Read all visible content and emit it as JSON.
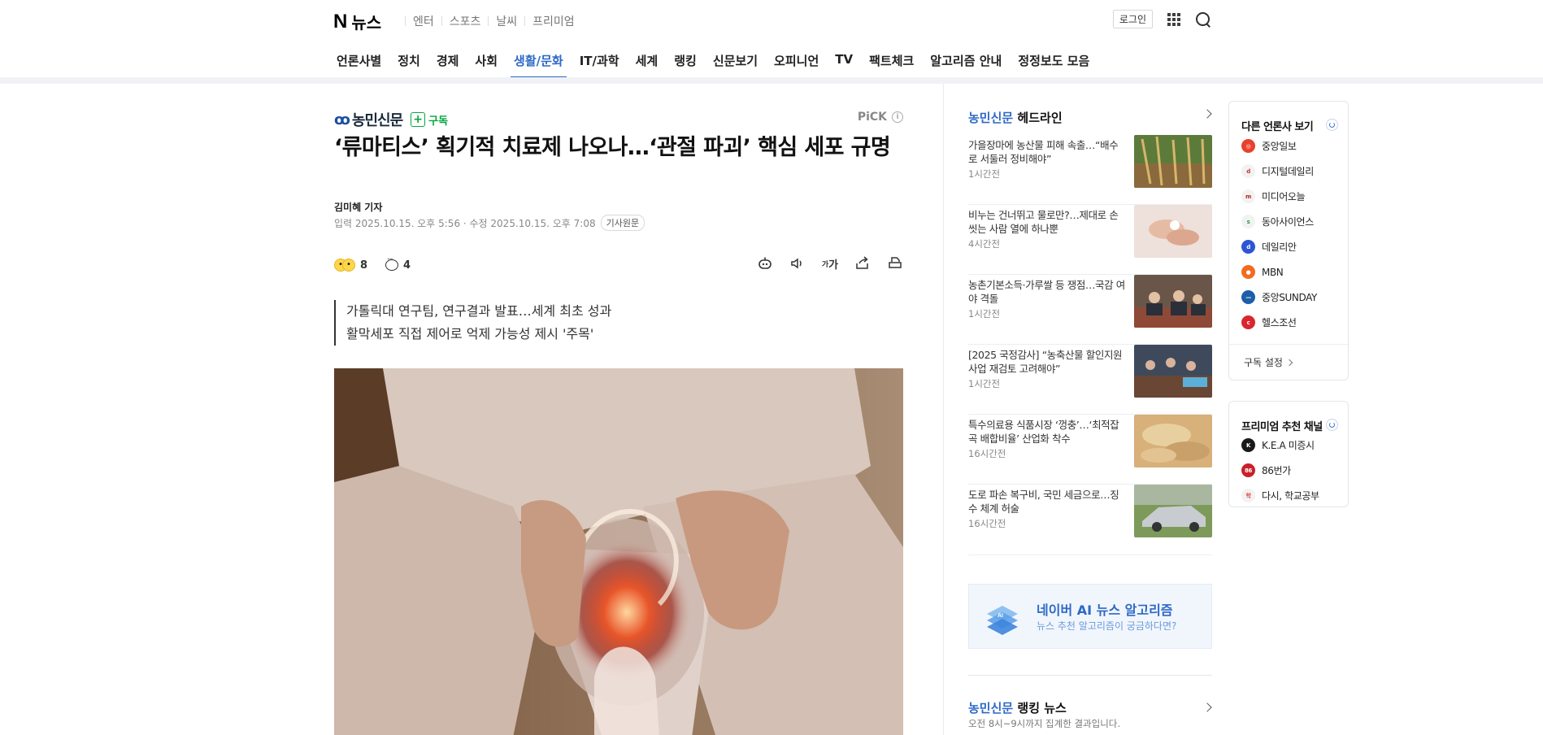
{
  "gnb": {
    "logo_n": "N",
    "logo_word": "뉴스",
    "services": [
      "엔터",
      "스포츠",
      "날씨",
      "프리미엄"
    ],
    "login": "로그인",
    "menu": [
      "언론사별",
      "정치",
      "경제",
      "사회",
      "생활/문화",
      "IT/과학",
      "세계",
      "랭킹",
      "신문보기",
      "오피니언",
      "TV",
      "팩트체크",
      "알고리즘 안내",
      "정정보도 모음"
    ],
    "active_menu": "생활/문화"
  },
  "article": {
    "press": "농민신문",
    "subscribe": "구독",
    "pick": "PiCK",
    "headline": "‘류마티스’ 획기적 치료제 나오나…‘관절 파괴’ 핵심 세포 규명",
    "reporter": "김미혜 기자",
    "dates": "입력 2025.10.15. 오후 5:56 · 수정 2025.10.15. 오후 7:08",
    "original_btn": "기사원문",
    "reaction_count": "8",
    "comment_count": "4",
    "font_tool": "가",
    "summary_lines": [
      "가톨릭대 연구팀, 연구결과 발표…세계 최초 성과",
      "활막세포 직접 제어로 억제 가능성 제시 '주목'"
    ]
  },
  "aside": {
    "press": "농민신문",
    "title_suffix": " 헤드라인",
    "items": [
      {
        "title": "가을장마에 농산물 피해 속출…“배수로 서둘러 정비해야”",
        "time": "1시간전"
      },
      {
        "title": "비누는 건너뛰고 물로만?…제대로 손 씻는 사람 열에 하나뿐",
        "time": "4시간전"
      },
      {
        "title": "농촌기본소득·가루쌀 등 쟁점…국감 여야 격돌",
        "time": "1시간전"
      },
      {
        "title": "[2025 국정감사] “농축산물 할인지원 사업 재검토 고려해야”",
        "time": "1시간전"
      },
      {
        "title": "특수의료용 식품시장 ‘껑충’…‘최적잡곡 배합비율’ 산업화 착수",
        "time": "16시간전"
      },
      {
        "title": "도로 파손 복구비, 국민 세금으로…징수 체계 허술",
        "time": "16시간전"
      }
    ],
    "ai_banner": {
      "title": "네이버 AI 뉴스 알고리즘",
      "sub": "뉴스 추천 알고리즘이 궁금하다면?"
    },
    "ranking_press": "농민신문",
    "ranking_suffix": " 랭킹 뉴스",
    "ranking_sub": "오전 8시~9시까지 집계한 결과입니다."
  },
  "panel_other": {
    "title": "다른 언론사 보기",
    "items": [
      {
        "name": "중앙일보",
        "color": "#e8412c"
      },
      {
        "name": "디지털데일리",
        "color": "#f2f2f2"
      },
      {
        "name": "미디어오늘",
        "color": "#f2f2f2"
      },
      {
        "name": "동아사이언스",
        "color": "#f2f2f2"
      },
      {
        "name": "데일리안",
        "color": "#2c55d6"
      },
      {
        "name": "MBN",
        "color": "#f26b21"
      },
      {
        "name": "중앙SUNDAY",
        "color": "#1c5ea8"
      },
      {
        "name": "헬스조선",
        "color": "#d9262e"
      }
    ],
    "setting": "구독 설정"
  },
  "panel_premium": {
    "title": "프리미엄 추천 채널",
    "items": [
      {
        "name": "K.E.A 미증시",
        "color": "#1a1a1a"
      },
      {
        "name": "86번가",
        "color": "#c9202a"
      },
      {
        "name": "다시, 학교공부",
        "color": "#f2f2f2"
      }
    ]
  }
}
